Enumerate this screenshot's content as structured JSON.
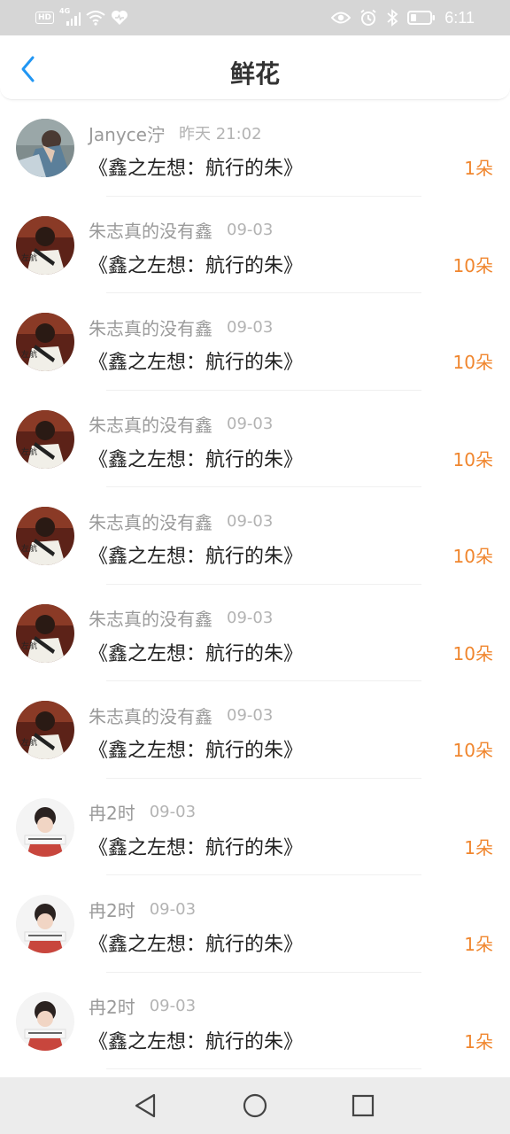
{
  "status_bar": {
    "hd": "HD",
    "network": "4G",
    "time": "6:11",
    "icons": [
      "signal-icon",
      "wifi-icon",
      "heart-icon",
      "eye-icon",
      "alarm-icon",
      "bluetooth-icon",
      "battery-icon"
    ]
  },
  "header": {
    "back_icon": "chevron-left-icon",
    "title": "鲜花",
    "accent_color": "#2196f3"
  },
  "list": {
    "count_color": "#f0862e",
    "items": [
      {
        "sender": "Janyce泞",
        "time": "昨天 21:02",
        "gift": "《鑫之左想：航行的朱》",
        "count": "1朵",
        "avatar": "janyce-avatar"
      },
      {
        "sender": "朱志真的没有鑫",
        "time": "09-03",
        "gift": "《鑫之左想：航行的朱》",
        "count": "10朵",
        "avatar": "zhu-avatar"
      },
      {
        "sender": "朱志真的没有鑫",
        "time": "09-03",
        "gift": "《鑫之左想：航行的朱》",
        "count": "10朵",
        "avatar": "zhu-avatar"
      },
      {
        "sender": "朱志真的没有鑫",
        "time": "09-03",
        "gift": "《鑫之左想：航行的朱》",
        "count": "10朵",
        "avatar": "zhu-avatar"
      },
      {
        "sender": "朱志真的没有鑫",
        "time": "09-03",
        "gift": "《鑫之左想：航行的朱》",
        "count": "10朵",
        "avatar": "zhu-avatar"
      },
      {
        "sender": "朱志真的没有鑫",
        "time": "09-03",
        "gift": "《鑫之左想：航行的朱》",
        "count": "10朵",
        "avatar": "zhu-avatar"
      },
      {
        "sender": "朱志真的没有鑫",
        "time": "09-03",
        "gift": "《鑫之左想：航行的朱》",
        "count": "10朵",
        "avatar": "zhu-avatar"
      },
      {
        "sender": "冉2时",
        "time": "09-03",
        "gift": "《鑫之左想：航行的朱》",
        "count": "1朵",
        "avatar": "ran-avatar"
      },
      {
        "sender": "冉2时",
        "time": "09-03",
        "gift": "《鑫之左想：航行的朱》",
        "count": "1朵",
        "avatar": "ran-avatar"
      },
      {
        "sender": "冉2时",
        "time": "09-03",
        "gift": "《鑫之左想：航行的朱》",
        "count": "1朵",
        "avatar": "ran-avatar"
      }
    ]
  },
  "nav_bar": {
    "back_icon": "triangle-back-icon",
    "home_icon": "circle-home-icon",
    "recent_icon": "square-recents-icon"
  }
}
